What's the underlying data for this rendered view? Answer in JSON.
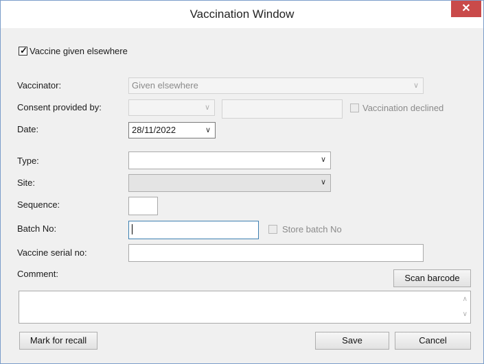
{
  "window": {
    "title": "Vaccination Window",
    "close_glyph": "✕"
  },
  "given_elsewhere": {
    "label": "Vaccine given elsewhere",
    "checked": true
  },
  "vaccinator": {
    "label": "Vaccinator:",
    "value": "Given elsewhere"
  },
  "consent": {
    "label": "Consent provided by:",
    "value": "",
    "text": ""
  },
  "declined": {
    "label": "Vaccination declined",
    "checked": false
  },
  "date": {
    "label": "Date:",
    "value": "28/11/2022"
  },
  "type": {
    "label": "Type:",
    "value": ""
  },
  "site": {
    "label": "Site:",
    "value": ""
  },
  "sequence": {
    "label": "Sequence:",
    "value": ""
  },
  "batch": {
    "label": "Batch No:",
    "value": ""
  },
  "store_batch": {
    "label": "Store batch No",
    "checked": false
  },
  "serial": {
    "label": "Vaccine serial no:",
    "value": ""
  },
  "comment": {
    "label": "Comment:",
    "value": ""
  },
  "buttons": {
    "scan_barcode": "Scan barcode",
    "mark_for_recall": "Mark for recall",
    "save": "Save",
    "cancel": "Cancel"
  },
  "icons": {
    "dropdown": "chevron-down-icon",
    "check": "checkmark-icon",
    "close": "close-icon"
  },
  "colors": {
    "close_button": "#c94a4a",
    "focus_border": "#3c7fb1",
    "window_border": "#7a9cc9"
  }
}
